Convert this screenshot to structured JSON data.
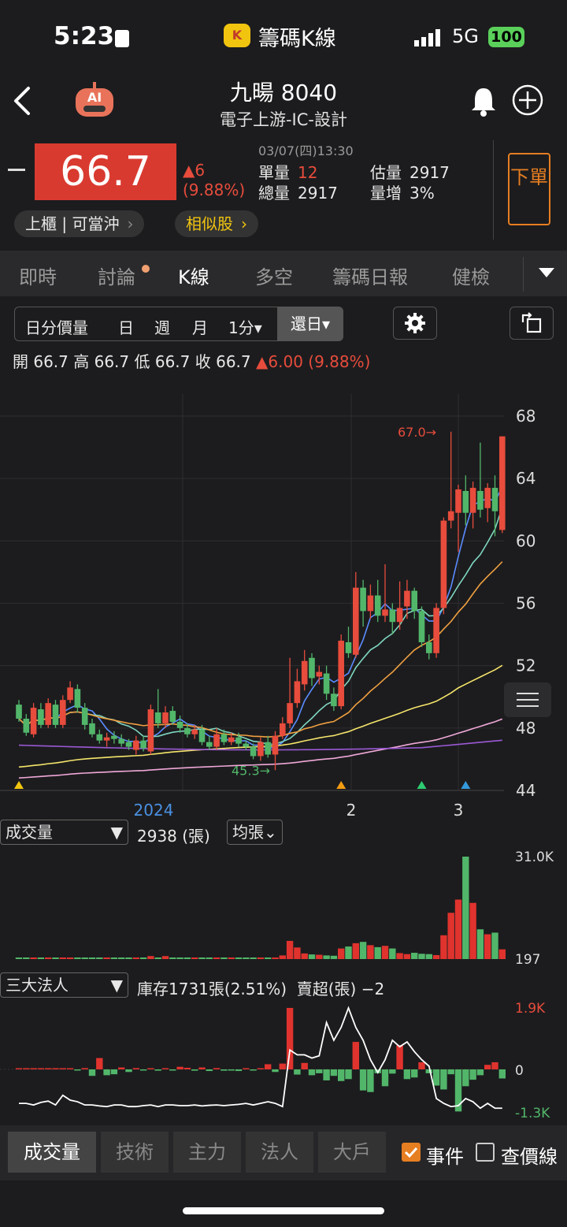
{
  "status": {
    "time": "5:23",
    "app_title": "籌碼K線",
    "network": "5G",
    "battery": "100"
  },
  "stock": {
    "name": "九暘 8040",
    "category": "電子上游-IC-設計",
    "price": "66.7",
    "change": "▲6",
    "change_pct": "(9.88%)",
    "datetime": "03/07(四)13:30",
    "unit_vol_label": "單量",
    "unit_vol": "12",
    "total_vol_label": "總量",
    "total_vol": "2917",
    "est_vol_label": "估量",
    "est_vol": "2917",
    "vol_inc_label": "量增",
    "vol_inc": "3%",
    "order_btn": "下單",
    "market_tag": "上櫃 | 可當沖",
    "similar_tag": "相似股"
  },
  "tabs": [
    "即時",
    "討論",
    "K線",
    "多空",
    "籌碼日報",
    "健檢"
  ],
  "period_bar": {
    "items": [
      "日分價量",
      "日",
      "週",
      "月",
      "1分▾"
    ],
    "active": "還日▾"
  },
  "ohlc": {
    "open": "開 66.7",
    "high": "高 66.7",
    "low": "低 66.7",
    "close": "收 66.7",
    "change": "▲6.00 (9.88%)"
  },
  "chart_data": {
    "type": "candlestick",
    "y_ticks": [
      "68",
      "64",
      "60",
      "56",
      "52",
      "48",
      "44"
    ],
    "ylim": [
      44,
      68
    ],
    "x_ticks": [
      "2024",
      "2",
      "3"
    ],
    "annotations": [
      "67.0→",
      "45.3→"
    ],
    "candles": [
      [
        49.5,
        48.6,
        49.8,
        48.4
      ],
      [
        48.6,
        47.7,
        48.9,
        47.5
      ],
      [
        47.6,
        49.3,
        49.6,
        47.4
      ],
      [
        49.2,
        48.2,
        49.6,
        48.0
      ],
      [
        48.2,
        49.6,
        49.9,
        48.0
      ],
      [
        49.5,
        48.2,
        49.8,
        48.0
      ],
      [
        48.2,
        49.8,
        50.1,
        48.0
      ],
      [
        49.8,
        50.6,
        51.0,
        49.6
      ],
      [
        50.5,
        49.3,
        50.8,
        49.0
      ],
      [
        49.3,
        48.2,
        49.6,
        47.9
      ],
      [
        48.3,
        47.6,
        48.6,
        47.4
      ],
      [
        47.6,
        47.2,
        47.9,
        47.0
      ],
      [
        47.2,
        47.4,
        47.7,
        46.8
      ],
      [
        47.5,
        47.3,
        47.8,
        47.0
      ],
      [
        47.3,
        47.0,
        47.6,
        46.8
      ],
      [
        47.1,
        46.8,
        47.3,
        46.6
      ],
      [
        46.6,
        47.2,
        47.5,
        46.3
      ],
      [
        47.2,
        46.7,
        47.5,
        46.5
      ],
      [
        46.5,
        49.2,
        49.5,
        46.3
      ],
      [
        49.0,
        48.3,
        50.5,
        48.0
      ],
      [
        48.3,
        49.0,
        49.4,
        48.0
      ],
      [
        49.1,
        48.4,
        49.4,
        48.2
      ],
      [
        48.4,
        48.0,
        48.8,
        47.7
      ],
      [
        48.0,
        47.6,
        48.3,
        47.4
      ],
      [
        47.6,
        47.9,
        48.2,
        47.3
      ],
      [
        47.9,
        47.1,
        48.2,
        46.9
      ],
      [
        47.1,
        46.8,
        47.5,
        46.6
      ],
      [
        46.8,
        47.6,
        48.0,
        46.6
      ],
      [
        47.6,
        47.1,
        47.9,
        46.9
      ],
      [
        47.1,
        47.4,
        47.7,
        46.9
      ],
      [
        47.4,
        47.0,
        47.7,
        46.8
      ],
      [
        47.0,
        46.8,
        47.2,
        46.6
      ],
      [
        46.8,
        46.2,
        47.0,
        46.0
      ],
      [
        46.2,
        47.1,
        47.4,
        45.9
      ],
      [
        47.1,
        46.3,
        47.5,
        46.1
      ],
      [
        46.3,
        47.5,
        47.8,
        45.3
      ],
      [
        47.5,
        48.3,
        48.7,
        47.3
      ],
      [
        48.3,
        49.6,
        52.5,
        48.0
      ],
      [
        49.6,
        51.0,
        51.8,
        49.3
      ],
      [
        50.8,
        52.3,
        53.0,
        50.4
      ],
      [
        52.5,
        51.2,
        52.8,
        50.7
      ],
      [
        51.3,
        51.6,
        52.0,
        50.8
      ],
      [
        51.5,
        50.2,
        52.0,
        49.8
      ],
      [
        50.2,
        49.4,
        50.6,
        49.1
      ],
      [
        49.4,
        53.6,
        54.0,
        49.2
      ],
      [
        53.5,
        52.8,
        54.5,
        52.5
      ],
      [
        52.7,
        57.0,
        58.0,
        52.5
      ],
      [
        57.0,
        55.5,
        57.5,
        54.5
      ],
      [
        55.5,
        56.5,
        57.2,
        55.0
      ],
      [
        56.5,
        55.2,
        57.5,
        54.8
      ],
      [
        55.2,
        55.6,
        58.5,
        54.8
      ],
      [
        55.6,
        54.8,
        56.0,
        54.0
      ],
      [
        54.8,
        55.7,
        57.4,
        54.3
      ],
      [
        55.8,
        56.8,
        57.5,
        55.0
      ],
      [
        56.8,
        55.5,
        57.0,
        55.0
      ],
      [
        55.5,
        53.5,
        55.8,
        53.2
      ],
      [
        53.5,
        52.8,
        54.0,
        52.4
      ],
      [
        52.8,
        55.7,
        56.0,
        52.5
      ],
      [
        55.7,
        61.3,
        61.5,
        55.3
      ],
      [
        61.3,
        61.9,
        67.0,
        60.8
      ],
      [
        61.8,
        63.3,
        63.6,
        59.3
      ],
      [
        63.2,
        61.8,
        64.2,
        61.0
      ],
      [
        61.8,
        63.4,
        63.8,
        60.8
      ],
      [
        63.2,
        62.0,
        66.3,
        61.5
      ],
      [
        62.1,
        63.4,
        63.7,
        61.2
      ],
      [
        63.4,
        61.9,
        64.2,
        60.3
      ],
      [
        60.7,
        66.7,
        66.7,
        60.5
      ]
    ],
    "markers": [
      {
        "index": 0,
        "color": "#f1c40f"
      },
      {
        "index": 44,
        "color": "#f39c12"
      },
      {
        "index": 55,
        "color": "#2ecc71"
      },
      {
        "index": 61,
        "color": "#3498db"
      }
    ]
  },
  "volume_panel": {
    "selector": "成交量",
    "value": "2938 (張)",
    "avg_selector": "均張⌄",
    "y_max": "31.0K",
    "y_min": "197",
    "values": [
      300,
      220,
      260,
      200,
      180,
      240,
      260,
      350,
      380,
      300,
      240,
      200,
      180,
      220,
      260,
      200,
      180,
      240,
      900,
      380,
      900,
      400,
      300,
      250,
      220,
      200,
      180,
      260,
      240,
      220,
      300,
      260,
      220,
      200,
      250,
      380,
      1100,
      5500,
      3500,
      1700,
      1400,
      1300,
      1100,
      1000,
      3200,
      3800,
      4800,
      5200,
      4200,
      3600,
      4000,
      3200,
      1800,
      1500,
      1900,
      1600,
      1500,
      1200,
      7200,
      14000,
      18000,
      31000,
      17000,
      9000,
      7500,
      8000,
      2938
    ],
    "up": [
      0,
      0,
      1,
      0,
      1,
      0,
      1,
      1,
      0,
      0,
      0,
      0,
      1,
      0,
      0,
      0,
      1,
      0,
      1,
      0,
      1,
      0,
      0,
      0,
      1,
      0,
      0,
      1,
      0,
      1,
      0,
      0,
      0,
      1,
      0,
      1,
      1,
      1,
      1,
      1,
      0,
      1,
      0,
      0,
      1,
      0,
      1,
      0,
      1,
      0,
      1,
      0,
      1,
      1,
      0,
      0,
      0,
      1,
      1,
      1,
      1,
      0,
      1,
      0,
      1,
      0,
      1
    ]
  },
  "inst_panel": {
    "selector": "三大法人",
    "summary": "庫存1731張(2.51%)  賣超(張) −2",
    "y_max": "1.9K",
    "y_mid": "0",
    "y_min": "-1.3K",
    "values": [
      0,
      0,
      0,
      0,
      0,
      0,
      0,
      20,
      -30,
      40,
      -200,
      350,
      -180,
      -150,
      60,
      -80,
      40,
      -20,
      30,
      -40,
      30,
      -30,
      80,
      50,
      -40,
      60,
      -50,
      40,
      -40,
      -20,
      -50,
      0,
      -30,
      20,
      160,
      -80,
      180,
      1900,
      -160,
      200,
      -180,
      -120,
      -340,
      -200,
      -360,
      -300,
      850,
      -650,
      -700,
      -120,
      -520,
      -130,
      750,
      -300,
      -250,
      220,
      -120,
      -500,
      -620,
      -150,
      -1300,
      -520,
      -320,
      -180,
      140,
      220,
      -280
    ],
    "line": [
      -1050,
      -1050,
      -1100,
      -1020,
      -980,
      -1100,
      -800,
      -950,
      -1000,
      -1100,
      -1100,
      -1130,
      -1150,
      -1100,
      -1100,
      -1150,
      -1150,
      -1120,
      -1100,
      -1150,
      -1100,
      -1100,
      -1120,
      -1120,
      -1100,
      -1130,
      -1110,
      -1100,
      -1120,
      -1100,
      -1080,
      -1050,
      -1100,
      -1050,
      -1000,
      -1050,
      -1150,
      600,
      450,
      450,
      350,
      420,
      1450,
      900,
      1300,
      1900,
      1300,
      900,
      300,
      -100,
      300,
      900,
      700,
      850,
      550,
      300,
      100,
      -900,
      -1050,
      -1150,
      -1120,
      -900,
      -1000,
      -1200,
      -1050,
      -1200,
      -1200
    ]
  },
  "bottom_tabs": [
    "成交量",
    "技術",
    "主力",
    "法人",
    "大戶"
  ],
  "checkboxes": {
    "event": "事件",
    "price_line": "查價線"
  }
}
